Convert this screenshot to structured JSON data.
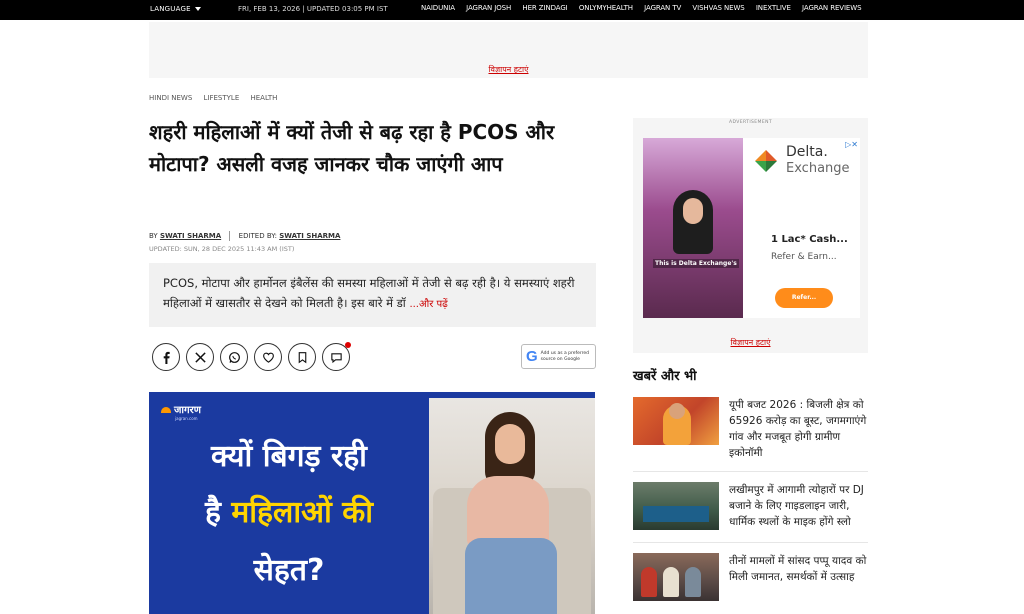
{
  "topbar": {
    "language": "LANGUAGE",
    "datetime": "FRI, FEB 13, 2026 | UPDATED 03:05 PM IST",
    "nav": [
      "NAIDUNIA",
      "JAGRAN JOSH",
      "HER ZINDAGI",
      "ONLYMYHEALTH",
      "JAGRAN TV",
      "VISHVAS NEWS",
      "INEXTLIVE",
      "JAGRAN REVIEWS"
    ]
  },
  "ad_top": {
    "link": "विज्ञापन हटाएं"
  },
  "breadcrumb": [
    "HINDI NEWS",
    "LIFESTYLE",
    "HEALTH"
  ],
  "article": {
    "headline": "शहरी महिलाओं में क्यों तेजी से बढ़ रहा है PCOS और मोटापा? असली वजह जानकर चौक जाएंगी आप",
    "by_label": "BY",
    "author": "SWATI SHARMA",
    "edited_label": "EDITED BY:",
    "editor": "SWATI SHARMA",
    "updated": "UPDATED: SUN, 28 DEC 2025 11:43 AM (IST)",
    "summary": "PCOS, मोटापा और हार्मोनल इंबैलेंस की समस्या महिलाओं में तेजी से बढ़ रही है। ये समस्याएं शहरी महिलाओं में खासतौर से देखने को मिलती है। इस बारे में डॉ",
    "read_more": "...और पढ़ें",
    "google_badge": [
      "Add us as a preferred",
      "source on Google"
    ],
    "hero": {
      "brand": "जागरण",
      "brand_sub": "jagran.com",
      "line1": "क्यों बिगड़ रही",
      "line2a": "है ",
      "line2b": "महिलाओं की",
      "line3": "सेहत?"
    }
  },
  "sidebar_ad": {
    "label": "ADVERTISEMENT",
    "brand_line1": "Delta.",
    "brand_line2": "Exchange",
    "video_caption": "This is Delta Exchange's",
    "offer": "1 Lac* Cash...",
    "refer": "Refer & Earn...",
    "cta": "Refer...",
    "link": "विज्ञापन हटाएं"
  },
  "more_news": {
    "title": "खबरें और भी",
    "items": [
      {
        "title": "यूपी बजट 2026 : बिजली क्षेत्र को 65926 करोड़ का बूस्ट, जगमगाएंगे गांव और मजबूत होगी ग्रामीण इकोनॉमी"
      },
      {
        "title": "लखीमपुर में आगामी त्योहारों पर DJ बजाने के लिए गाइडलाइन जारी, धार्मिक स्थलों के माइक होंगे स्लो"
      },
      {
        "title": "तीनों मामलों में सांसद पप्पू यादव को मिली जमानत, समर्थकों में उत्साह"
      }
    ]
  },
  "colors": {
    "accent_red": "#cc0000",
    "hero_blue": "#1b3aa0",
    "hero_yellow": "#ffd400",
    "cta_orange": "#ff8c1a"
  }
}
